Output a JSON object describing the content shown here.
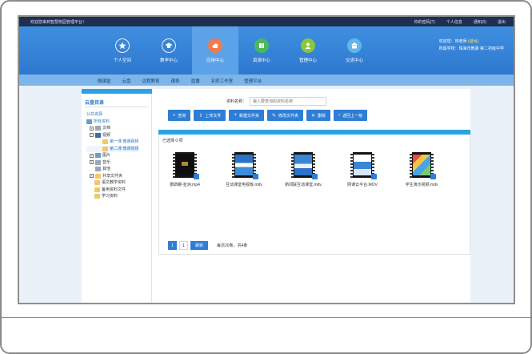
{
  "topbar": {
    "welcome": "欢迎您来到智慧校园管理平台！",
    "links": [
      "你的密码(?)",
      "个人信息",
      "通知(0)",
      "退出"
    ]
  },
  "nav": [
    {
      "label": "个人空间",
      "icon": "star-icon"
    },
    {
      "label": "教学中心",
      "icon": "graduation-cap-icon"
    },
    {
      "label": "应用中心",
      "icon": "cloud-icon",
      "active": true
    },
    {
      "label": "资源中心",
      "icon": "grid-icon"
    },
    {
      "label": "管理中心",
      "icon": "user-icon"
    },
    {
      "label": "交流中心",
      "icon": "building-icon"
    }
  ],
  "user": {
    "greeting": "欢迎您：",
    "name": "林老师",
    "role": "(退出)",
    "school": "所属学校：珠海市教委  第二初级中学"
  },
  "subnav": [
    "微课堂",
    "云盘",
    "远程教育",
    "课表",
    "直播",
    "名师工作室",
    "管理平台"
  ],
  "left": {
    "title": "云盘目录",
    "public": "公共资源",
    "tree": [
      {
        "label": "所有资料",
        "level": 0,
        "icon": "grid-icon"
      },
      {
        "label": "文档",
        "level": 1,
        "icon": "doc-icon",
        "pm": "+"
      },
      {
        "label": "视频",
        "level": 1,
        "icon": "video-icon",
        "pm": "-"
      },
      {
        "label": "第一课 微课视频",
        "level": 2,
        "icon": "folder-icon"
      },
      {
        "label": "第二课 微课视频",
        "level": 2,
        "icon": "folder-icon",
        "selected": true
      },
      {
        "label": "图片",
        "level": 1,
        "icon": "picture-icon",
        "pm": "+"
      },
      {
        "label": "音乐",
        "level": 1,
        "icon": "doc-icon",
        "pm": "+"
      },
      {
        "label": "其他",
        "level": 1,
        "icon": "doc-icon"
      },
      {
        "label": "共享文件夹",
        "level": 1,
        "icon": "folder-icon",
        "pm": "+"
      },
      {
        "label": "语文教学资料",
        "level": 2,
        "icon": "folder-icon"
      },
      {
        "label": "备用资料文件",
        "level": 2,
        "icon": "folder-icon"
      },
      {
        "label": "学习资料",
        "level": 2,
        "icon": "folder-icon"
      }
    ]
  },
  "search": {
    "label": "资料名称：",
    "placeholder": "输入要查询的资料名称"
  },
  "toolbar": [
    {
      "label": "查询",
      "icon": "search-icon",
      "glyph": "⌕"
    },
    {
      "label": "上传文件",
      "icon": "upload-icon",
      "glyph": "⇧"
    },
    {
      "label": "新建文件夹",
      "icon": "plus-icon",
      "glyph": "+"
    },
    {
      "label": "修改文件夹",
      "icon": "pencil-icon",
      "glyph": "✎"
    },
    {
      "label": "删除",
      "icon": "trash-icon",
      "glyph": "🗑"
    },
    {
      "label": "返回上一级",
      "icon": "back-icon",
      "glyph": "‹"
    }
  ],
  "panel": {
    "selected_text": "已选择 0 项"
  },
  "files": [
    {
      "name": "鹦鹉螺-亚洲.mp4",
      "style": "dark"
    },
    {
      "name": "互动课堂电视板.mdv",
      "style": "screen"
    },
    {
      "name": "新闻联互动课堂.mdv",
      "style": "screen"
    },
    {
      "name": "网课云平台.MOV",
      "style": "screen"
    },
    {
      "name": "学生演示视频.mdv",
      "style": "colorful"
    }
  ],
  "pager": {
    "pages": [
      "1"
    ],
    "current": "1",
    "go_label": "跳转",
    "info": "每页20条，共4条"
  },
  "colors": {
    "header": "#3f8fe0",
    "accent": "#2e7ed6",
    "topbar": "#1f2f4f"
  }
}
